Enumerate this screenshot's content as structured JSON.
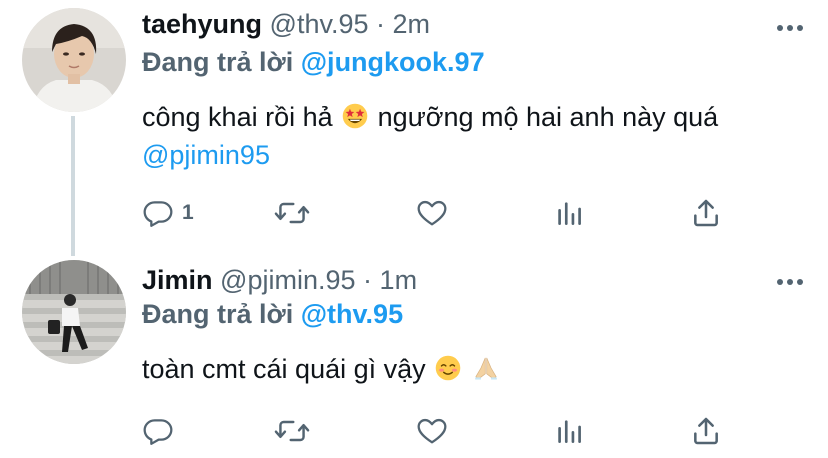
{
  "tweets": [
    {
      "display_name": "taehyung",
      "handle": "@thv.95",
      "separator": "·",
      "time": "2m",
      "reply_prefix": "Đang trả lời",
      "reply_to": "@jungkook.97",
      "text_part1": "công khai rồi hả",
      "emoji1": "star-struck-emoji",
      "text_part2": "ngưỡng mộ hai anh này quá",
      "text_mention": "@pjimin95",
      "reply_count": "1",
      "icons": [
        "reply-icon",
        "retweet-icon",
        "like-icon",
        "stats-icon",
        "share-icon",
        "more-icon"
      ]
    },
    {
      "display_name": "Jimin",
      "handle": "@pjimin.95",
      "separator": "·",
      "time": "1m",
      "reply_prefix": "Đang trả lời",
      "reply_to": "@thv.95",
      "text_part1": "toàn cmt cái quái gì vậy",
      "emoji1": "smiling-blush-emoji",
      "emoji2": "folded-hands-emoji",
      "icons": [
        "reply-icon",
        "retweet-icon",
        "like-icon",
        "stats-icon",
        "share-icon",
        "more-icon"
      ]
    }
  ],
  "colors": {
    "text": "#0f1419",
    "secondary": "#536471",
    "accent": "#1d9bf0",
    "thread_line": "#cfd9de"
  }
}
